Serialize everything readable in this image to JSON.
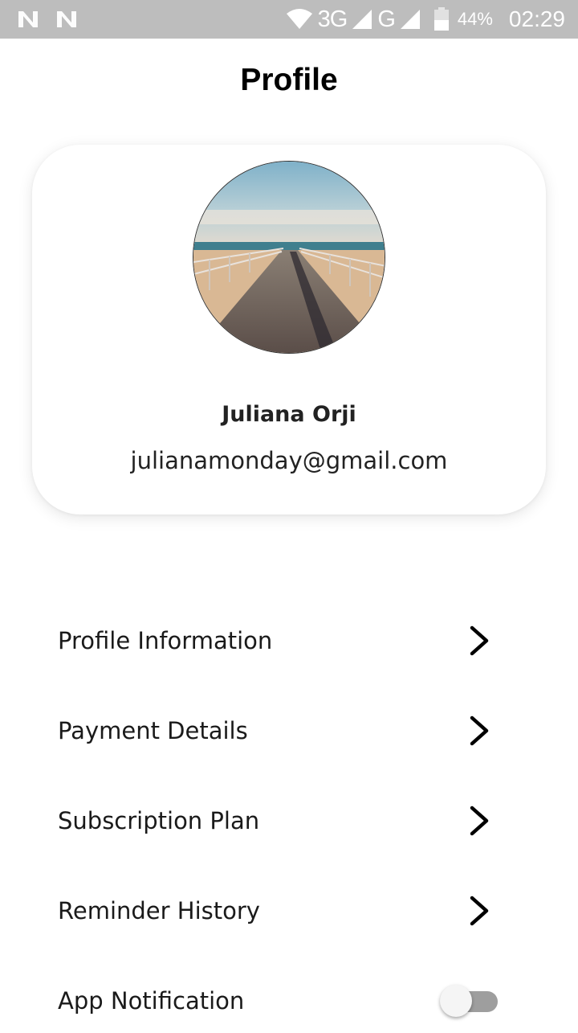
{
  "status_bar": {
    "network_3g": "3G",
    "network_g": "G",
    "battery_percent": "44%",
    "time": "02:29",
    "icons": [
      "notification-n-icon",
      "notification-n-icon",
      "wifi-icon",
      "signal-icon",
      "signal-icon",
      "battery-icon"
    ]
  },
  "header": {
    "title": "Profile"
  },
  "profile": {
    "name": "Juliana Orji",
    "email": "julianamonday@gmail.com",
    "avatar_icon": "avatar-photo-boardwalk"
  },
  "menu": {
    "items": [
      {
        "label": "Profile Information",
        "icon": "chevron-right-icon"
      },
      {
        "label": "Payment Details",
        "icon": "chevron-right-icon"
      },
      {
        "label": "Subscription Plan",
        "icon": "chevron-right-icon"
      },
      {
        "label": "Reminder History",
        "icon": "chevron-right-icon"
      }
    ],
    "notification": {
      "label": "App Notification",
      "enabled": false
    }
  },
  "colors": {
    "status_bar_bg": "#bdbdbd",
    "toggle_track_off": "#9e9e9e",
    "text": "#1a1a1a"
  }
}
